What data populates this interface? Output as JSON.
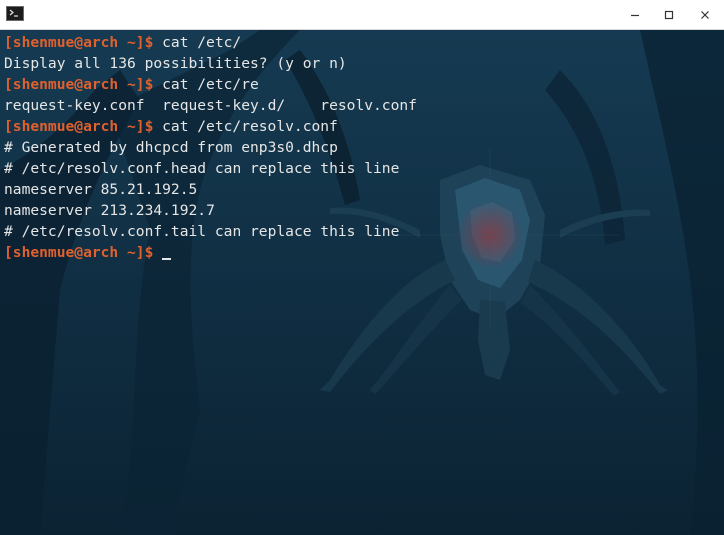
{
  "window": {
    "icon": "terminal-icon",
    "controls": [
      "minimize-icon",
      "maximize-icon",
      "close-icon"
    ]
  },
  "terminal": {
    "prompt": "[shenmue@arch ~]$",
    "lines": [
      {
        "type": "cmd",
        "text": "cat /etc/"
      },
      {
        "type": "out",
        "text": "Display all 136 possibilities? (y or n)"
      },
      {
        "type": "cmd",
        "text": "cat /etc/re"
      },
      {
        "type": "out",
        "text": "request-key.conf  request-key.d/    resolv.conf"
      },
      {
        "type": "cmd",
        "text": "cat /etc/resolv.conf"
      },
      {
        "type": "out",
        "text": "# Generated by dhcpcd from enp3s0.dhcp"
      },
      {
        "type": "out",
        "text": "# /etc/resolv.conf.head can replace this line"
      },
      {
        "type": "out",
        "text": "nameserver 85.21.192.5"
      },
      {
        "type": "out",
        "text": "nameserver 213.234.192.7"
      },
      {
        "type": "out",
        "text": "# /etc/resolv.conf.tail can replace this line"
      },
      {
        "type": "cmd",
        "text": ""
      }
    ]
  },
  "colors": {
    "prompt": "#e0602e",
    "text": "#e6e6e6",
    "background": "#0e2a3e"
  }
}
